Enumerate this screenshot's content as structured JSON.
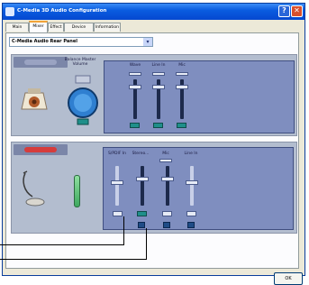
{
  "window": {
    "title": "C-Media 3D Audio Configuration",
    "help_glyph": "?",
    "close_glyph": "✕"
  },
  "tabs": [
    {
      "label": "Main Setting",
      "active": false
    },
    {
      "label": "Mixer",
      "active": true
    },
    {
      "label": "Effect",
      "active": false
    },
    {
      "label": "Device Setting",
      "active": false
    },
    {
      "label": "Information",
      "active": false
    }
  ],
  "device_select": {
    "value": "C-Media Audio Rear Panel",
    "arrow": "▾"
  },
  "playback": {
    "section_icon": "speaker-icon",
    "balance_label": "Balance Master Volume",
    "channels": [
      {
        "label": "Wave"
      },
      {
        "label": "Line In"
      },
      {
        "label": "Mic"
      }
    ]
  },
  "recording": {
    "section_icon": "microphone-icon",
    "channels": [
      {
        "label": "S/PDIF In"
      },
      {
        "label": "Stereo..."
      },
      {
        "label": "Mic"
      },
      {
        "label": "Line In"
      }
    ]
  },
  "footer": {
    "ok_label": "OK"
  },
  "colors": {
    "titlebar": "#0a5ce0",
    "section": "#b3bdcf",
    "mixer": "#7f8ebf",
    "mute": "#1f8f8a",
    "select": "#1f4c86",
    "level": "#3da85f",
    "record_accent": "#d63c3c"
  }
}
